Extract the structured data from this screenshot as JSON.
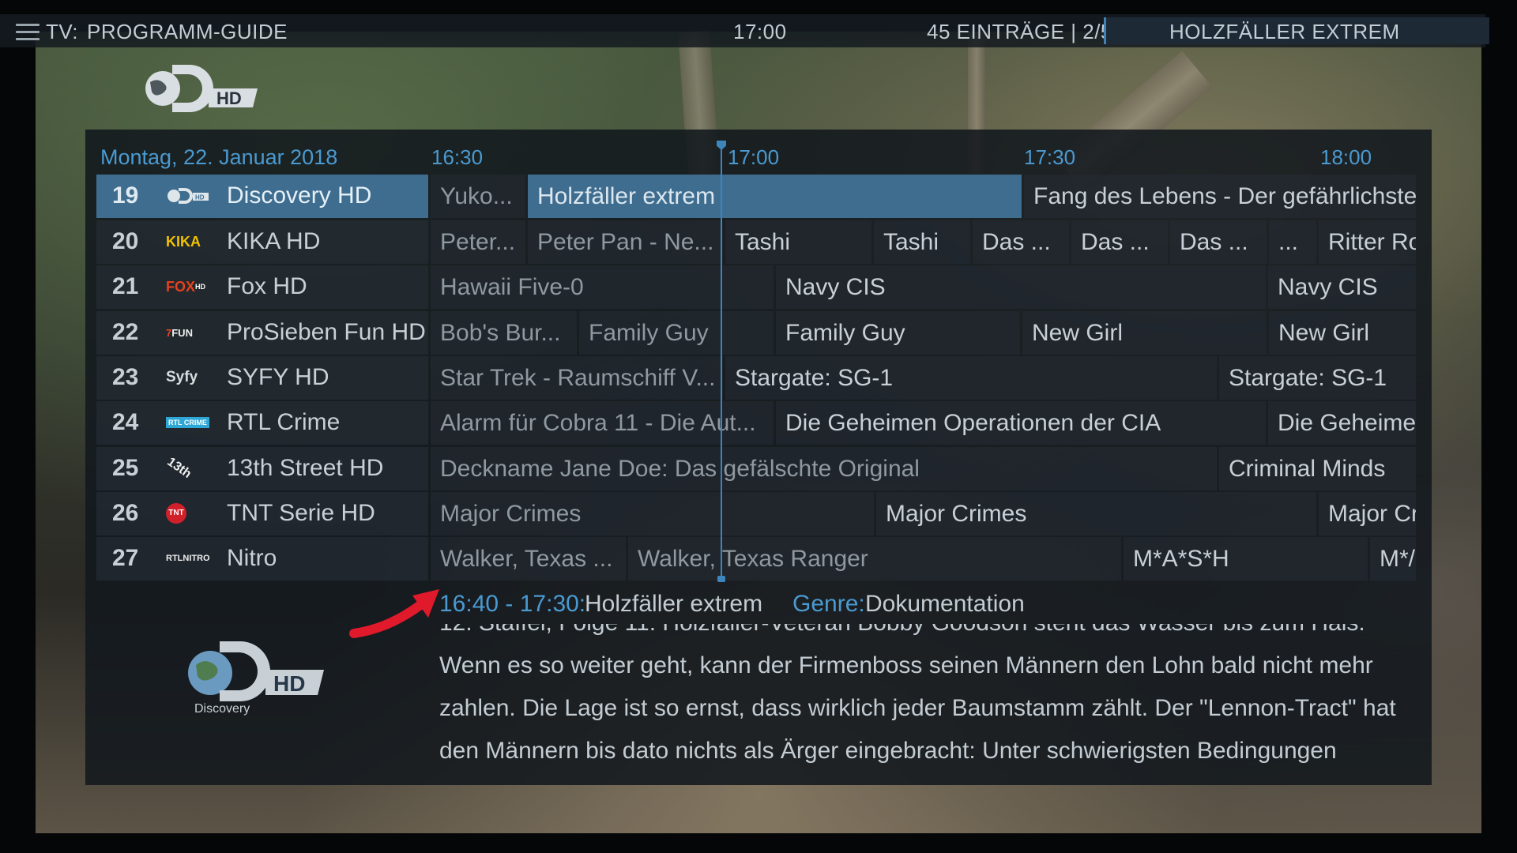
{
  "header": {
    "section": "TV:",
    "title": "PROGRAMM-GUIDE",
    "clock": "17:00",
    "entries": "45 EINTRÄGE | 2/5",
    "selected_program": "HOLZFÄLLER EXTREM"
  },
  "guide": {
    "date": "Montag, 22. Januar 2018",
    "times": [
      "16:30",
      "17:00",
      "17:30",
      "18:00"
    ],
    "channels": [
      {
        "number": "19",
        "logo": "DHD",
        "name": "Discovery HD",
        "active": true,
        "programs": [
          {
            "title": "Yuko..."
          },
          {
            "title": "Holzfäller extrem",
            "selected": true
          },
          {
            "title": "Fang des Lebens - Der gefährlichste J"
          }
        ]
      },
      {
        "number": "20",
        "logo": "KIKA",
        "name": "KIKA HD",
        "programs": [
          {
            "title": "Peter..."
          },
          {
            "title": "Peter Pan - Ne..."
          },
          {
            "title": "Tashi"
          },
          {
            "title": "Tashi"
          },
          {
            "title": "Das ..."
          },
          {
            "title": "Das ..."
          },
          {
            "title": "Das ..."
          },
          {
            "title": "..."
          },
          {
            "title": "Ritter Ro"
          }
        ]
      },
      {
        "number": "21",
        "logo": "FOX",
        "name": "Fox HD",
        "programs": [
          {
            "title": "Hawaii Five-0"
          },
          {
            "title": "Navy CIS"
          },
          {
            "title": "Navy CIS"
          }
        ]
      },
      {
        "number": "22",
        "logo": "FUN",
        "name": "ProSieben Fun HD",
        "programs": [
          {
            "title": "Bob's Bur..."
          },
          {
            "title": "Family Guy"
          },
          {
            "title": "Family Guy"
          },
          {
            "title": "New Girl"
          },
          {
            "title": "New Girl"
          }
        ]
      },
      {
        "number": "23",
        "logo": "Syfy",
        "name": "SYFY HD",
        "programs": [
          {
            "title": "Star Trek - Raumschiff V..."
          },
          {
            "title": "Stargate: SG-1"
          },
          {
            "title": "Stargate: SG-1"
          }
        ]
      },
      {
        "number": "24",
        "logo": "RTL CRIME",
        "name": "RTL Crime",
        "programs": [
          {
            "title": "Alarm für Cobra 11 - Die Aut..."
          },
          {
            "title": "Die Geheimen Operationen der CIA"
          },
          {
            "title": "Die Geheimer"
          }
        ]
      },
      {
        "number": "25",
        "logo": "13th",
        "name": "13th Street HD",
        "programs": [
          {
            "title": "Deckname Jane Doe: Das gefälschte Original"
          },
          {
            "title": "Criminal Minds"
          }
        ]
      },
      {
        "number": "26",
        "logo": "TNT",
        "name": "TNT Serie HD",
        "programs": [
          {
            "title": "Major Crimes"
          },
          {
            "title": "Major Crimes"
          },
          {
            "title": "Major Cr"
          }
        ]
      },
      {
        "number": "27",
        "logo": "RTLNITRO",
        "name": "Nitro",
        "programs": [
          {
            "title": "Walker, Texas ..."
          },
          {
            "title": "Walker, Texas Ranger"
          },
          {
            "title": "M*A*S*H"
          },
          {
            "title": "M*/"
          }
        ]
      }
    ]
  },
  "info": {
    "time": "16:40 - 17:30:",
    "title": "Holzfäller extrem",
    "genre_label": "Genre:",
    "genre": "Dokumentation",
    "description": "12. Staffel, Folge 11: Holzfäller-Veteran Bobby Goodson steht das Wasser bis zum Hals. Wenn es so weiter geht, kann der Firmenboss seinen Männern den Lohn bald nicht mehr zahlen. Die Lage ist so ernst, dass wirklich jeder Baumstamm zählt. Der \"Lennon-Tract\" hat den Männern bis dato nichts als Ärger eingebracht: Unter schwierigsten Bedingungen minderwertiges Holz"
  },
  "logos": {
    "hd_text": "HD",
    "discovery_text": "Discovery"
  },
  "colors": {
    "accent": "#4a9ad1",
    "selection": "#3f6d8f",
    "arrow": "#e0192b"
  }
}
